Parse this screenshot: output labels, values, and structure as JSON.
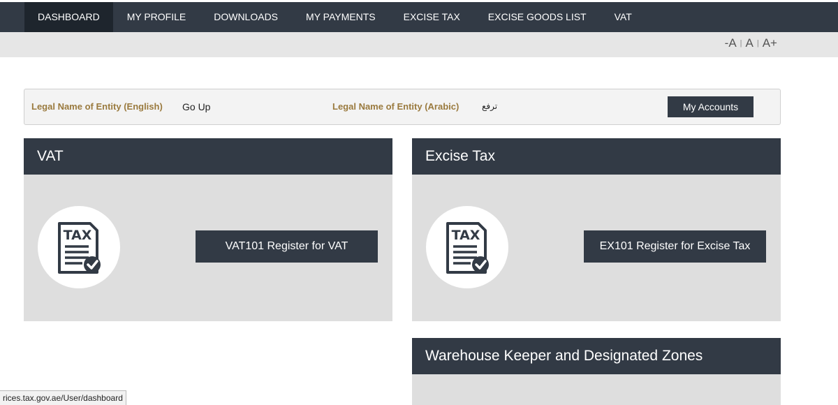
{
  "nav": {
    "items": [
      {
        "label": "DASHBOARD",
        "active": true
      },
      {
        "label": "MY PROFILE"
      },
      {
        "label": "DOWNLOADS"
      },
      {
        "label": "MY PAYMENTS"
      },
      {
        "label": "EXCISE TAX"
      },
      {
        "label": "EXCISE GOODS LIST"
      },
      {
        "label": "VAT"
      }
    ]
  },
  "font_controls": {
    "decrease": "-A",
    "reset": "A",
    "increase": "A+",
    "separator": "|"
  },
  "entity": {
    "english_label": "Legal Name of Entity (English)",
    "english_value": "Go Up",
    "arabic_label": "Legal Name of Entity (Arabic)",
    "arabic_value": "ترفع",
    "accounts_button": "My Accounts"
  },
  "cards": {
    "vat": {
      "title": "VAT",
      "icon_text": "TAX",
      "button": "VAT101 Register for VAT",
      "icon": "tax-document-icon"
    },
    "excise": {
      "title": "Excise Tax",
      "icon_text": "TAX",
      "button": "EX101 Register for Excise Tax",
      "icon": "tax-document-icon"
    },
    "warehouse": {
      "title": "Warehouse Keeper and Designated Zones"
    }
  },
  "status_url": "rices.tax.gov.ae/User/dashboard",
  "colors": {
    "nav_bg": "#323a45",
    "nav_active": "#1e252d",
    "label_gold": "#9a7a3e",
    "card_bg": "#dedede"
  }
}
